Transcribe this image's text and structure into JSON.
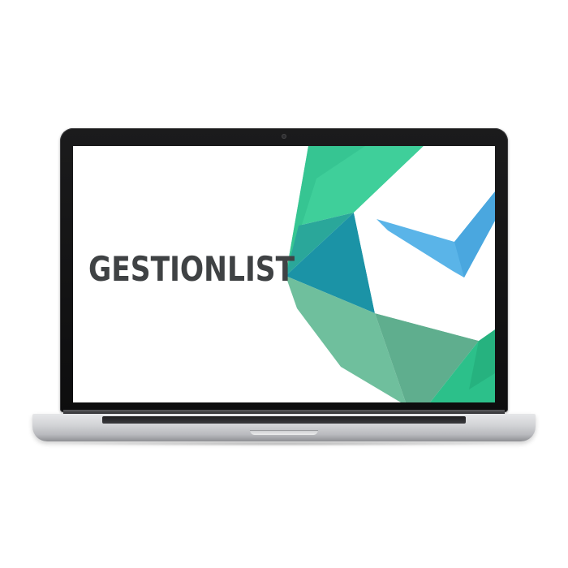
{
  "screen": {
    "brand_name": "GESTIONLIST"
  },
  "colors": {
    "brand_text": "#3f4244",
    "teal_dark": "#1a93a6",
    "green_bright": "#33c48d",
    "green_mid": "#2fb88a",
    "green_muted": "#6dbb9a",
    "checkmark_blue": "#5ab4e8",
    "bezel": "#111112",
    "aluminum": "#d3d4d7"
  },
  "icons": {
    "logo_mark": "checkmark-logo-icon",
    "webcam": "webcam-icon"
  }
}
